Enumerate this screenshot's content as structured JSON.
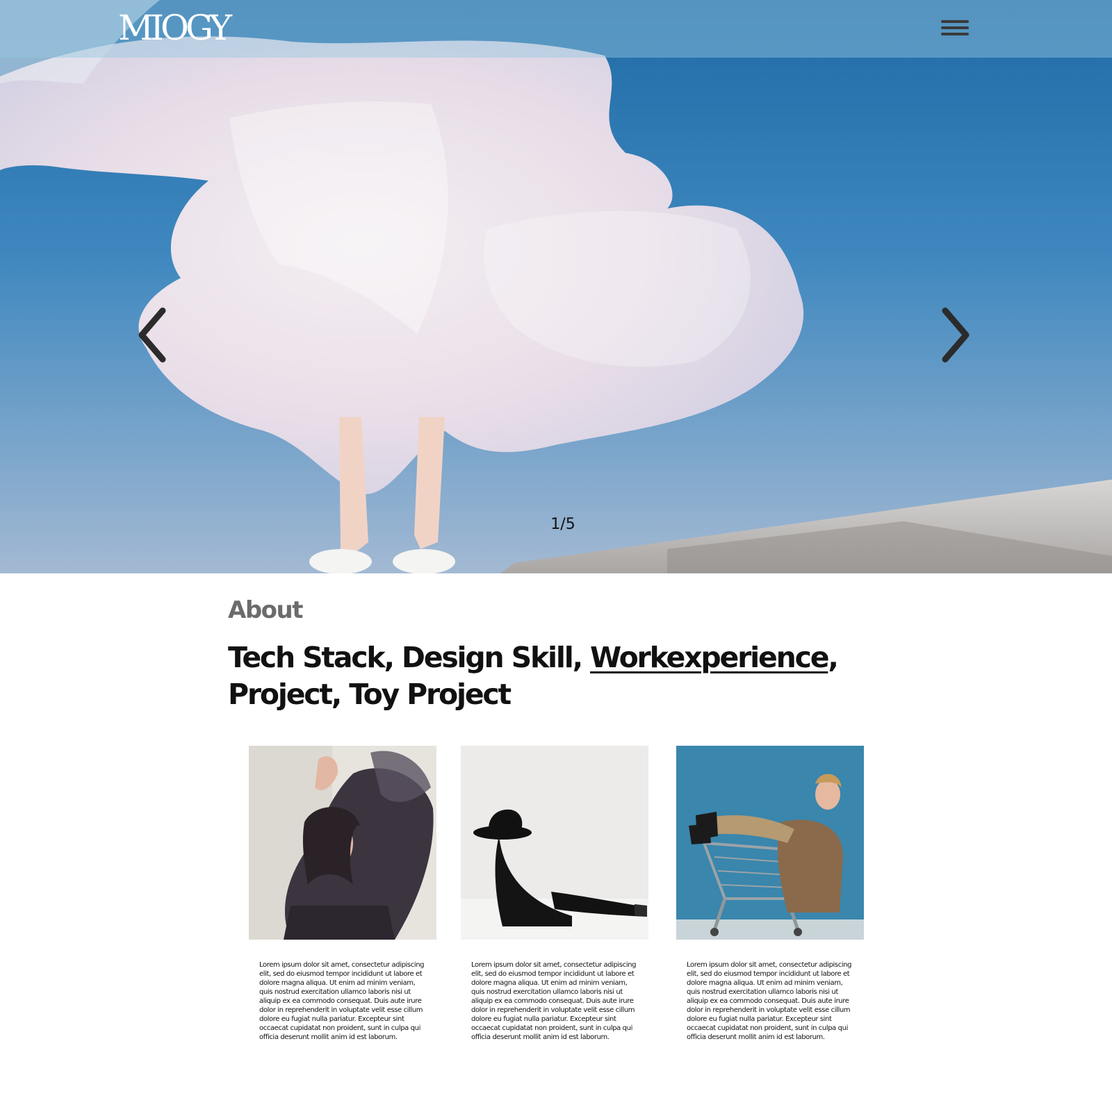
{
  "header": {
    "logo": "MIOGY",
    "menu_icon": "hamburger-menu-icon"
  },
  "hero": {
    "slide_current": 1,
    "slide_total": 5,
    "counter": "1/5",
    "prev_icon": "chevron-left-icon",
    "next_icon": "chevron-right-icon",
    "sky_color": "#2f78b0"
  },
  "about": {
    "label": "About",
    "headline_part1": "Tech Stack, Design Skill, ",
    "headline_link": "Workexperience",
    "headline_part2": ",",
    "headline_line2": "Project, Toy Project"
  },
  "cards": [
    {
      "text": "Lorem ipsum dolor sit amet, consectetur adipiscing elit,  sed do eiusmod tempor incididunt ut labore et dolore magna aliqua. Ut enim ad minim veniam, quis nostrud exercitation ullamco laboris nisi ut aliquip ex ea commodo consequat. Duis aute irure dolor in reprehenderit in voluptate velit esse cillum dolore eu fugiat nulla pariatur. Excepteur sint occaecat cupidatat non proident, sunt in culpa qui officia deserunt mollit anim id est laborum."
    },
    {
      "text": "Lorem ipsum dolor sit amet, consectetur adipiscing elit,  sed do eiusmod tempor incididunt ut labore et dolore magna aliqua. Ut enim ad minim veniam, quis nostrud exercitation ullamco laboris nisi ut aliquip ex ea commodo consequat. Duis aute irure dolor in reprehenderit in voluptate velit esse cillum dolore eu fugiat nulla pariatur. Excepteur sint occaecat cupidatat non proident, sunt in culpa qui officia deserunt mollit anim id est laborum."
    },
    {
      "text": "Lorem ipsum dolor sit amet, consectetur adipiscing elit,  sed do eiusmod tempor incididunt ut labore et dolore magna aliqua. Ut enim ad minim veniam, quis nostrud exercitation ullamco laboris nisi ut aliquip ex ea commodo consequat. Duis aute irure dolor in reprehenderit in voluptate velit esse cillum dolore eu fugiat nulla pariatur. Excepteur sint occaecat cupidatat non proident, sunt in culpa qui officia deserunt mollit anim id est laborum."
    }
  ]
}
